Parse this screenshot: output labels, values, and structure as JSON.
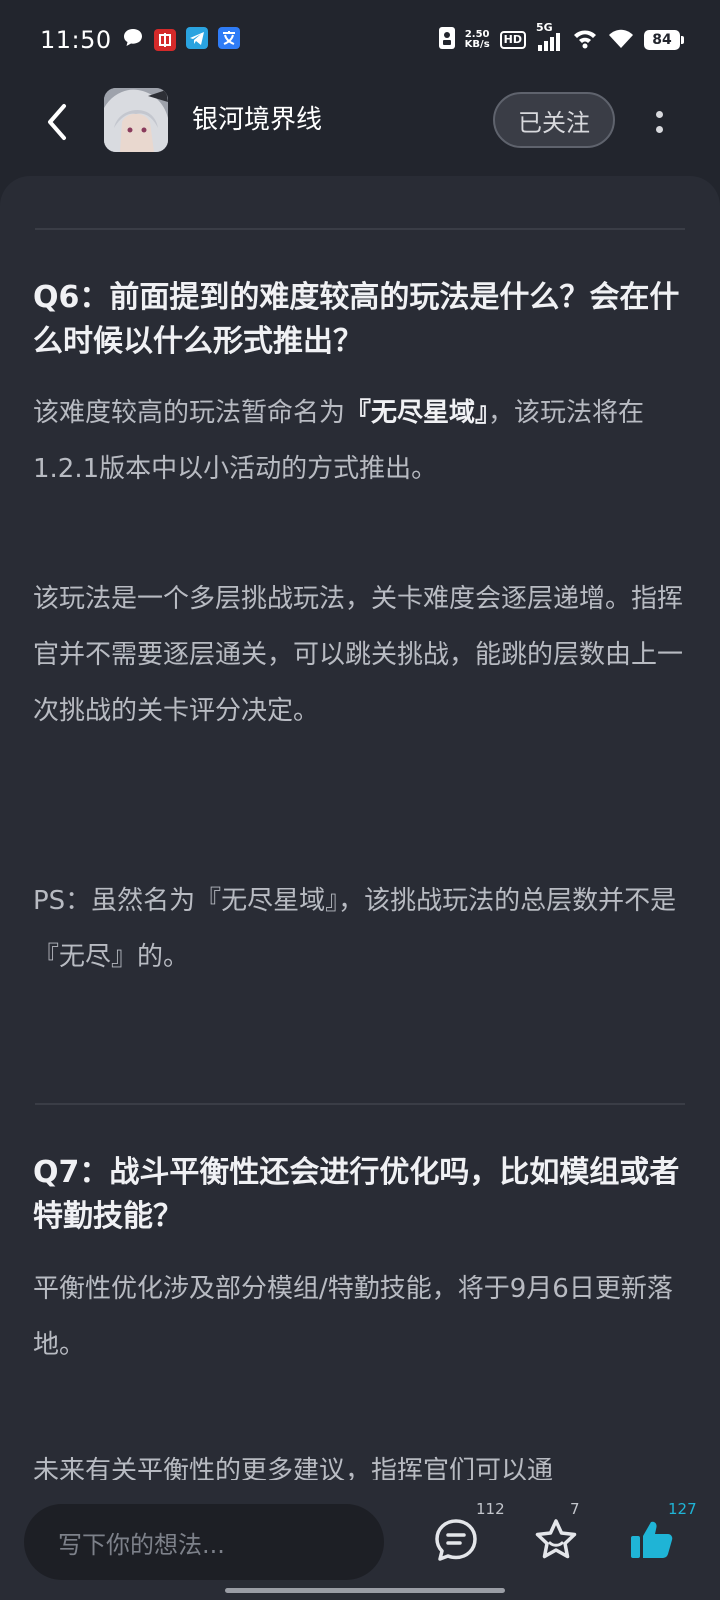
{
  "status_bar": {
    "time": "11:50",
    "net_speed_value": "2.50",
    "net_speed_unit": "KB/s",
    "hd": "HD",
    "network": "5G",
    "battery": "84"
  },
  "header": {
    "title": "银河境界线",
    "follow_label": "已关注"
  },
  "sections": [
    {
      "question": "Q6：前面提到的难度较高的玩法是什么？会在什么时候以什么形式推出？",
      "p1_before": "该难度较高的玩法暂命名为",
      "p1_bold": "『无尽星域』",
      "p1_after": "，该玩法将在1.2.1版本中以小活动的方式推出。",
      "p2": "该玩法是一个多层挑战玩法，关卡难度会逐层递增。指挥官并不需要逐层通关，可以跳关挑战，能跳的层数由上一次挑战的关卡评分决定。",
      "p3": "PS：虽然名为『无尽星域』，该挑战玩法的总层数并不是『无尽』的。"
    },
    {
      "question": "Q7：战斗平衡性还会进行优化吗，比如模组或者特勤技能？",
      "p1": "平衡性优化涉及部分模组/特勤技能，将于9月6日更新落地。",
      "p2_partial": "未来有关平衡性的更多建议，指挥官们可以通"
    }
  ],
  "bottom_bar": {
    "input_placeholder": "写下你的想法...",
    "comment_count": "112",
    "favorite_count": "7",
    "like_count": "127",
    "like_color": "#1fb4d6"
  },
  "icons": [
    "chat-bubble-icon",
    "telegram-icon",
    "translate-icon",
    "back-arrow-icon",
    "more-vertical-icon",
    "comment-icon",
    "star-icon",
    "thumbs-up-icon"
  ]
}
